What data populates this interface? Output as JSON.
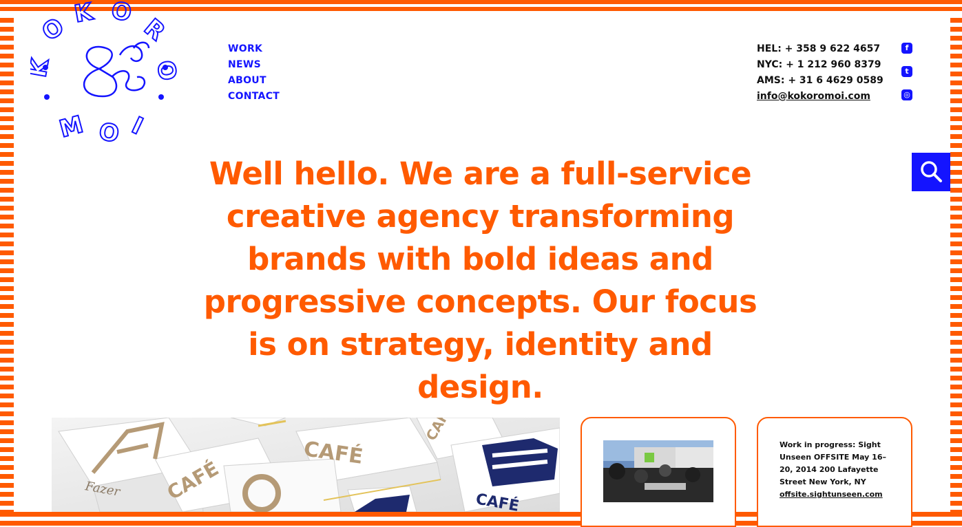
{
  "brand": {
    "logo_letters": {
      "top": [
        "O",
        "K",
        "O"
      ],
      "left": [
        "K"
      ],
      "right": [
        "R",
        "O"
      ],
      "bottom": [
        "M",
        "O",
        "I"
      ]
    }
  },
  "nav": {
    "items": [
      {
        "label": "WORK"
      },
      {
        "label": "NEWS"
      },
      {
        "label": "ABOUT"
      },
      {
        "label": "CONTACT"
      }
    ]
  },
  "contact": {
    "hel": "HEL: + 358 9 622 4657",
    "nyc": "NYC: + 1 212 960 8379",
    "ams": "AMS: + 31 6 4629 0589",
    "email": "info@kokoromoi.com"
  },
  "social": {
    "facebook": {
      "icon": "facebook-icon",
      "glyph": "f"
    },
    "twitter": {
      "icon": "twitter-icon",
      "glyph": "t"
    },
    "instagram": {
      "icon": "instagram-icon",
      "glyph": "◎"
    }
  },
  "search": {
    "icon": "search-icon"
  },
  "hero": {
    "text": "Well hello. We are a full-service creative agency transforming brands with bold ideas and progressive concepts. Our focus is on strategy, identity and design."
  },
  "feature": {
    "box_labels": [
      "CAFÉ",
      "CAFÉ",
      "CAFÉ",
      "CAFÉ",
      "CAFÉ",
      "Fazer"
    ]
  },
  "news_card": {
    "text": "Work in progress: Sight Unseen OFFSITE May 16–20, 2014 200 Lafayette Street New York, NY",
    "link": "offsite.sightunseen.com"
  },
  "colors": {
    "orange": "#ff5a00",
    "blue": "#1414ff",
    "text": "#111111"
  }
}
